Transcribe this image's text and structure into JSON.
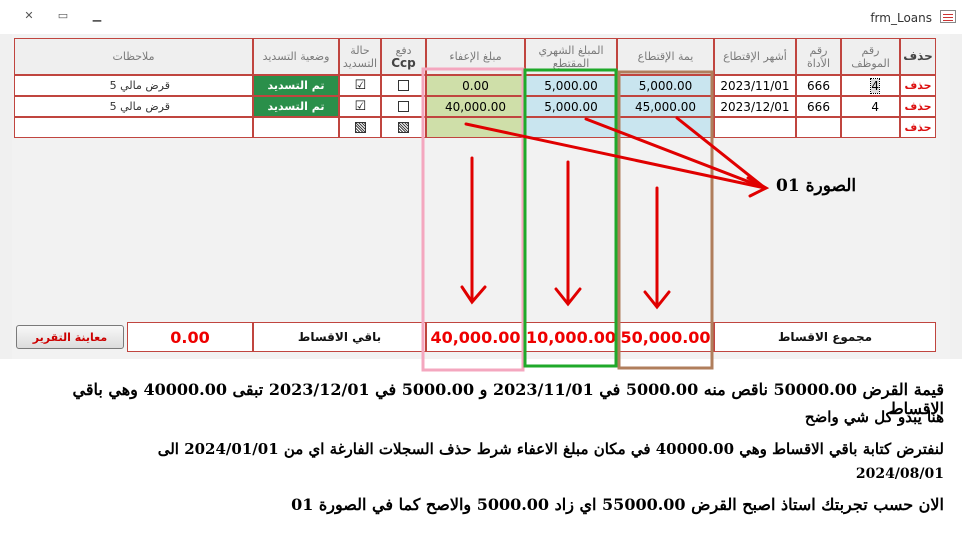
{
  "window": {
    "title": "frm_Loans",
    "controls": {
      "close": "✕",
      "restore": "▭",
      "minimize": "▁"
    }
  },
  "headers": {
    "delete": "حذف",
    "emp_no": "رقم الموظف",
    "tool_no": "رقم الأداة",
    "months": "أشهر الإقتطاع",
    "deduction_value": "يمة الإقتطاع",
    "monthly_amount": "المبلغ الشهري المقتطع",
    "exemption_amount": "مبلغ الإعفاء",
    "ccp_1": "دفع",
    "ccp_2": "Ccp",
    "pay_status": "حالة التسديد",
    "pay_state": "وضعية التسديد",
    "notes": "ملاحظات"
  },
  "rows": [
    {
      "delete": "حذف",
      "emp_no": "4",
      "tool_no": "666",
      "month": "2023/11/01",
      "deduction_value": "5,000.00",
      "monthly_amount": "5,000.00",
      "exemption_amount": "0.00",
      "ccp": "☐",
      "paid": "☑",
      "state": "تم التسديد",
      "note": "قرض مالي 5"
    },
    {
      "delete": "حذف",
      "emp_no": "4",
      "tool_no": "666",
      "month": "2023/12/01",
      "deduction_value": "45,000.00",
      "monthly_amount": "5,000.00",
      "exemption_amount": "40,000.00",
      "ccp": "☐",
      "paid": "☑",
      "state": "تم التسديد",
      "note": "قرض مالي 5"
    }
  ],
  "new_row": {
    "delete": "حذف"
  },
  "footer": {
    "total_label": "مجموع الاقساط",
    "total_deduction": "50,000.00",
    "total_monthly": "10,000.00",
    "total_exemption": "40,000.00",
    "remaining_label": "باقي الاقساط",
    "remaining_value": "0.00",
    "report_button": "معاينة التقرير"
  },
  "annotation": {
    "figure_label": "الصورة 01"
  },
  "notes": [
    "قيمة القرض 50000.00 ناقص منه 5000.00 في 2023/11/01 و 5000.00 في 2023/12/01 تبقى 40000.00 وهي باقي الاقساط",
    "هنا يبدو كل شي واضح",
    "لنفترض كتابة باقي الاقساط وهي 40000.00 في مكان مبلغ الاعفاء شرط حذف السجلات الفارغة اي من 2024/01/01 الى",
    "2024/08/01",
    "الان حسب تجربتك استاذ اصبح القرض 55000.00 اي زاد 5000.00 والاصح كما في الصورة 01"
  ],
  "colors": {
    "grid_border": "#c0453f",
    "pink_box": "#f4a7bf",
    "green_box": "#1fa92a",
    "brown_box": "#b07e5c",
    "arrow": "#e00000"
  }
}
